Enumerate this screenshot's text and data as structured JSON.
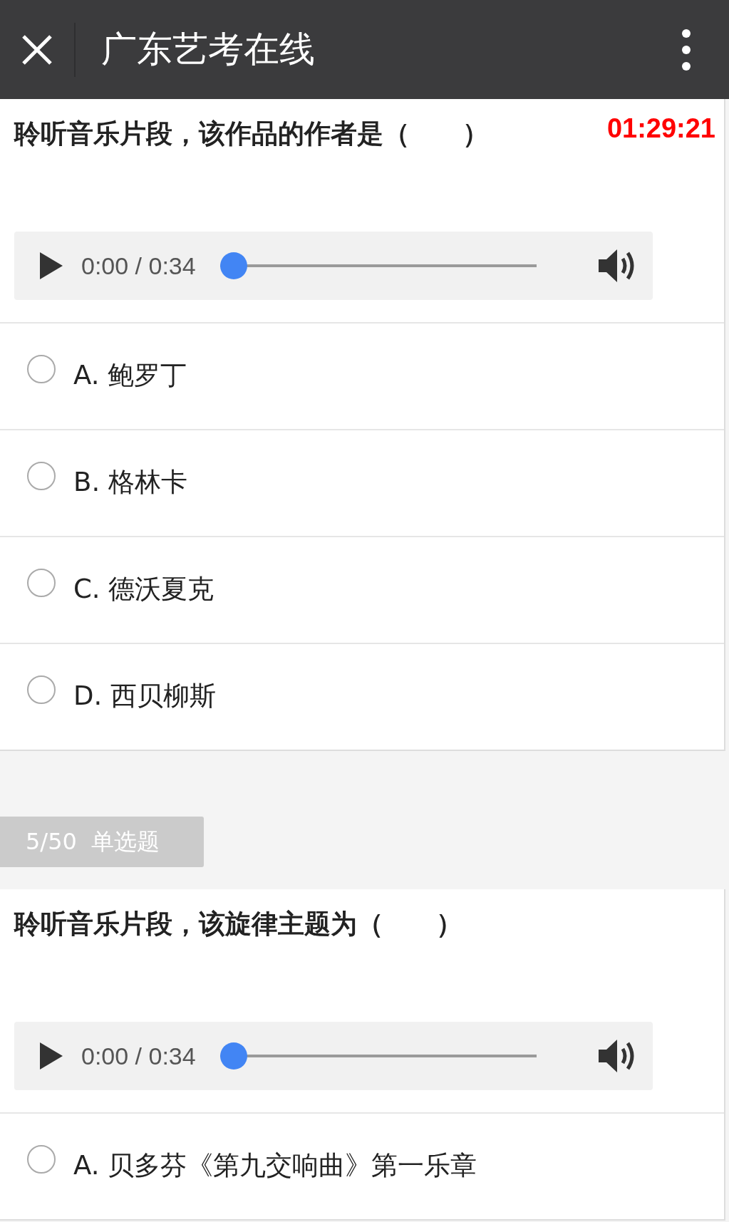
{
  "app_bar": {
    "title": "广东艺考在线"
  },
  "questions": [
    {
      "text": "聆听音乐片段，该作品的作者是（　　）",
      "timer": "01:29:21",
      "audio": {
        "time": "0:00 / 0:34",
        "level": 0
      },
      "options": [
        {
          "label": "A. 鲍罗丁",
          "selected": false
        },
        {
          "label": "B. 格林卡",
          "selected": false
        },
        {
          "label": "C. 德沃夏克",
          "selected": false
        },
        {
          "label": "D. 西贝柳斯",
          "selected": false
        }
      ]
    },
    {
      "badge": "5/50  单选题",
      "text": "聆听音乐片段，该旋律主题为（　　）",
      "audio": {
        "time": "0:00 / 0:34",
        "level": 0
      },
      "options": [
        {
          "label": "A. 贝多芬《第九交响曲》第一乐章",
          "selected": false
        }
      ]
    }
  ]
}
